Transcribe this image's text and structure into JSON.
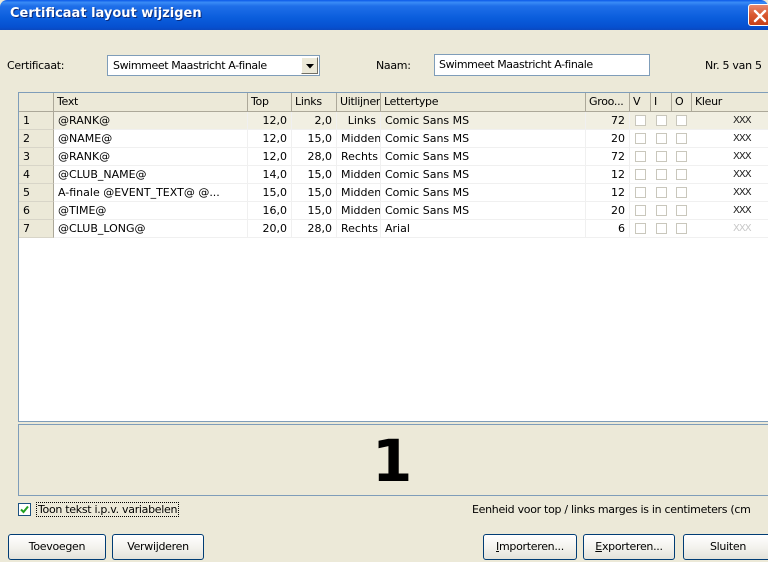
{
  "window": {
    "title": "Certificaat layout wijzigen"
  },
  "certificaat": {
    "label": "Certificaat:",
    "value": "Swimmeet Maastricht A-finale"
  },
  "naam": {
    "label": "Naam:",
    "value": "Swimmeet Maastricht A-finale"
  },
  "record_counter": "Nr. 5 van 5",
  "grid": {
    "columns": [
      "Text",
      "Top",
      "Links",
      "Uitlijnen",
      "Lettertype",
      "Groo...",
      "V",
      "I",
      "O",
      "Kleur"
    ],
    "rows": [
      {
        "num": "1",
        "text": "@RANK@",
        "top": "12,0",
        "links": "2,0",
        "uitlijnen": "Links",
        "lettertype": "Comic Sans MS",
        "grootte": "72",
        "v": false,
        "i": false,
        "o": false,
        "kleur": "XXX",
        "selected": true
      },
      {
        "num": "2",
        "text": "@NAME@",
        "top": "12,0",
        "links": "15,0",
        "uitlijnen": "Midden",
        "lettertype": "Comic Sans MS",
        "grootte": "20",
        "v": false,
        "i": false,
        "o": false,
        "kleur": "XXX"
      },
      {
        "num": "3",
        "text": "@RANK@",
        "top": "12,0",
        "links": "28,0",
        "uitlijnen": "Rechts",
        "lettertype": "Comic Sans MS",
        "grootte": "72",
        "v": false,
        "i": false,
        "o": false,
        "kleur": "XXX"
      },
      {
        "num": "4",
        "text": "@CLUB_NAME@",
        "top": "14,0",
        "links": "15,0",
        "uitlijnen": "Midden",
        "lettertype": "Comic Sans MS",
        "grootte": "12",
        "v": false,
        "i": false,
        "o": false,
        "kleur": "XXX"
      },
      {
        "num": "5",
        "text": "A-finale @EVENT_TEXT@ @...",
        "top": "15,0",
        "links": "15,0",
        "uitlijnen": "Midden",
        "lettertype": "Comic Sans MS",
        "grootte": "12",
        "v": false,
        "i": false,
        "o": false,
        "kleur": "XXX"
      },
      {
        "num": "6",
        "text": "@TIME@",
        "top": "16,0",
        "links": "15,0",
        "uitlijnen": "Midden",
        "lettertype": "Comic Sans MS",
        "grootte": "20",
        "v": false,
        "i": false,
        "o": false,
        "kleur": "XXX"
      },
      {
        "num": "7",
        "text": "@CLUB_LONG@",
        "top": "20,0",
        "links": "28,0",
        "uitlijnen": "Rechts",
        "lettertype": "Arial",
        "grootte": "6",
        "v": false,
        "i": false,
        "o": false,
        "kleur": "XXX",
        "kleur_light": true
      }
    ]
  },
  "preview": {
    "text": "1"
  },
  "toon_tekst": {
    "label": "Toon tekst i.p.v. variabelen",
    "checked": true
  },
  "eenheid_text": "Eenheid voor top / links marges is in centimeters (cm",
  "buttons": {
    "toevoegen": "Toevoegen",
    "verwijderen": "Verwijderen",
    "importeren": "Importeren...",
    "exporteren": "Exporteren...",
    "sluiten": "Sluiten"
  }
}
